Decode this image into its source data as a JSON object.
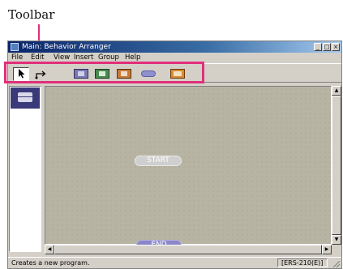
{
  "callouts": {
    "toolbar_label": "Toolbar"
  },
  "window": {
    "title": "Main: Behavior Arranger",
    "minimize": "_",
    "maximize": "□",
    "close": "×"
  },
  "menu": [
    "File",
    "Edit",
    "View",
    "Insert",
    "Group",
    "Help"
  ],
  "toolbar": {
    "buttons": [
      "select-tool",
      "connect-tool",
      "action-tool-a",
      "action-tool-b",
      "action-tool-c",
      "group-tool",
      "action-tool-d"
    ]
  },
  "canvas": {
    "start_label": "START",
    "end_label": "END"
  },
  "status": {
    "message": "Creates a new program.",
    "model": "[ERS-210(E)]"
  },
  "colors": {
    "callout": "#e0307a",
    "title_bar": "#0a246a",
    "canvas": "#b8b4a4",
    "end_node": "#8a86c8",
    "palette_selected": "#3a3a7a"
  }
}
